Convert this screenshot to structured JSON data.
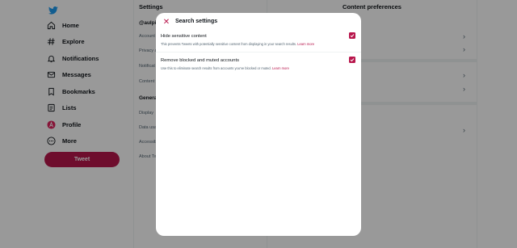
{
  "nav": {
    "items": [
      {
        "label": "Home",
        "icon": "home-icon"
      },
      {
        "label": "Explore",
        "icon": "hashtag-icon"
      },
      {
        "label": "Notifications",
        "icon": "bell-icon"
      },
      {
        "label": "Messages",
        "icon": "envelope-icon"
      },
      {
        "label": "Bookmarks",
        "icon": "bookmark-icon"
      },
      {
        "label": "Lists",
        "icon": "list-icon"
      },
      {
        "label": "Profile",
        "icon": "avatar-icon"
      },
      {
        "label": "More",
        "icon": "more-icon"
      }
    ],
    "tweet_label": "Tweet"
  },
  "settings": {
    "title": "Settings",
    "rows": [
      "@aulpi",
      "Account",
      "Privacy a",
      "Notificat",
      "Content y",
      "Genera",
      "Display",
      "Data usa",
      "Accessib",
      "About Tw"
    ]
  },
  "preferences": {
    "title": "Content preferences"
  },
  "modal": {
    "title": "Search settings",
    "options": [
      {
        "label": "Hide sensitive content",
        "description": "This prevents Tweets with potentially sensitive content from displaying in your search results.",
        "link": "Learn more",
        "checked": true
      },
      {
        "label": "Remove blocked and muted accounts",
        "description": "Use this to eliminate search results from accounts you've blocked or muted.",
        "link": "Learn more",
        "checked": true
      }
    ]
  },
  "colors": {
    "accent": "#b8164c",
    "twitter_blue": "#1d9bf0",
    "overlay": "rgba(0,0,0,0.4)"
  }
}
